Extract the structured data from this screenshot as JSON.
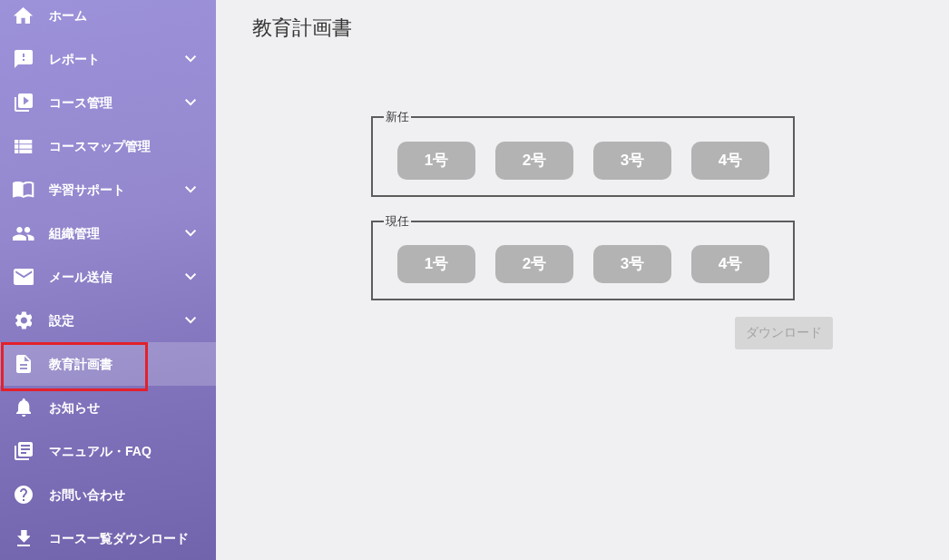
{
  "sidebar": {
    "items": [
      {
        "label": "ホーム",
        "expandable": false,
        "selected": false,
        "highlighted": false
      },
      {
        "label": "レポート",
        "expandable": true,
        "selected": false,
        "highlighted": false
      },
      {
        "label": "コース管理",
        "expandable": true,
        "selected": false,
        "highlighted": false
      },
      {
        "label": "コースマップ管理",
        "expandable": false,
        "selected": false,
        "highlighted": false
      },
      {
        "label": "学習サポート",
        "expandable": true,
        "selected": false,
        "highlighted": false
      },
      {
        "label": "組織管理",
        "expandable": true,
        "selected": false,
        "highlighted": false
      },
      {
        "label": "メール送信",
        "expandable": true,
        "selected": false,
        "highlighted": false
      },
      {
        "label": "設定",
        "expandable": true,
        "selected": false,
        "highlighted": false
      },
      {
        "label": "教育計画書",
        "expandable": false,
        "selected": true,
        "highlighted": true
      },
      {
        "label": "お知らせ",
        "expandable": false,
        "selected": false,
        "highlighted": false
      },
      {
        "label": "マニュアル・FAQ",
        "expandable": false,
        "selected": false,
        "highlighted": false
      },
      {
        "label": "お問い合わせ",
        "expandable": false,
        "selected": false,
        "highlighted": false
      },
      {
        "label": "コース一覧ダウンロード",
        "expandable": false,
        "selected": false,
        "highlighted": false
      }
    ]
  },
  "page_title": "教育計画書",
  "groups": [
    {
      "legend": "新任",
      "buttons": [
        {
          "label": "1号",
          "selected": false
        },
        {
          "label": "2号",
          "selected": false
        },
        {
          "label": "3号",
          "selected": false
        },
        {
          "label": "4号",
          "selected": false
        }
      ]
    },
    {
      "legend": "現任",
      "buttons": [
        {
          "label": "1号",
          "selected": false
        },
        {
          "label": "2号",
          "selected": false
        },
        {
          "label": "3号",
          "selected": false
        },
        {
          "label": "4号",
          "selected": false
        }
      ]
    }
  ],
  "download_button": {
    "label": "ダウンロード",
    "disabled": true
  }
}
